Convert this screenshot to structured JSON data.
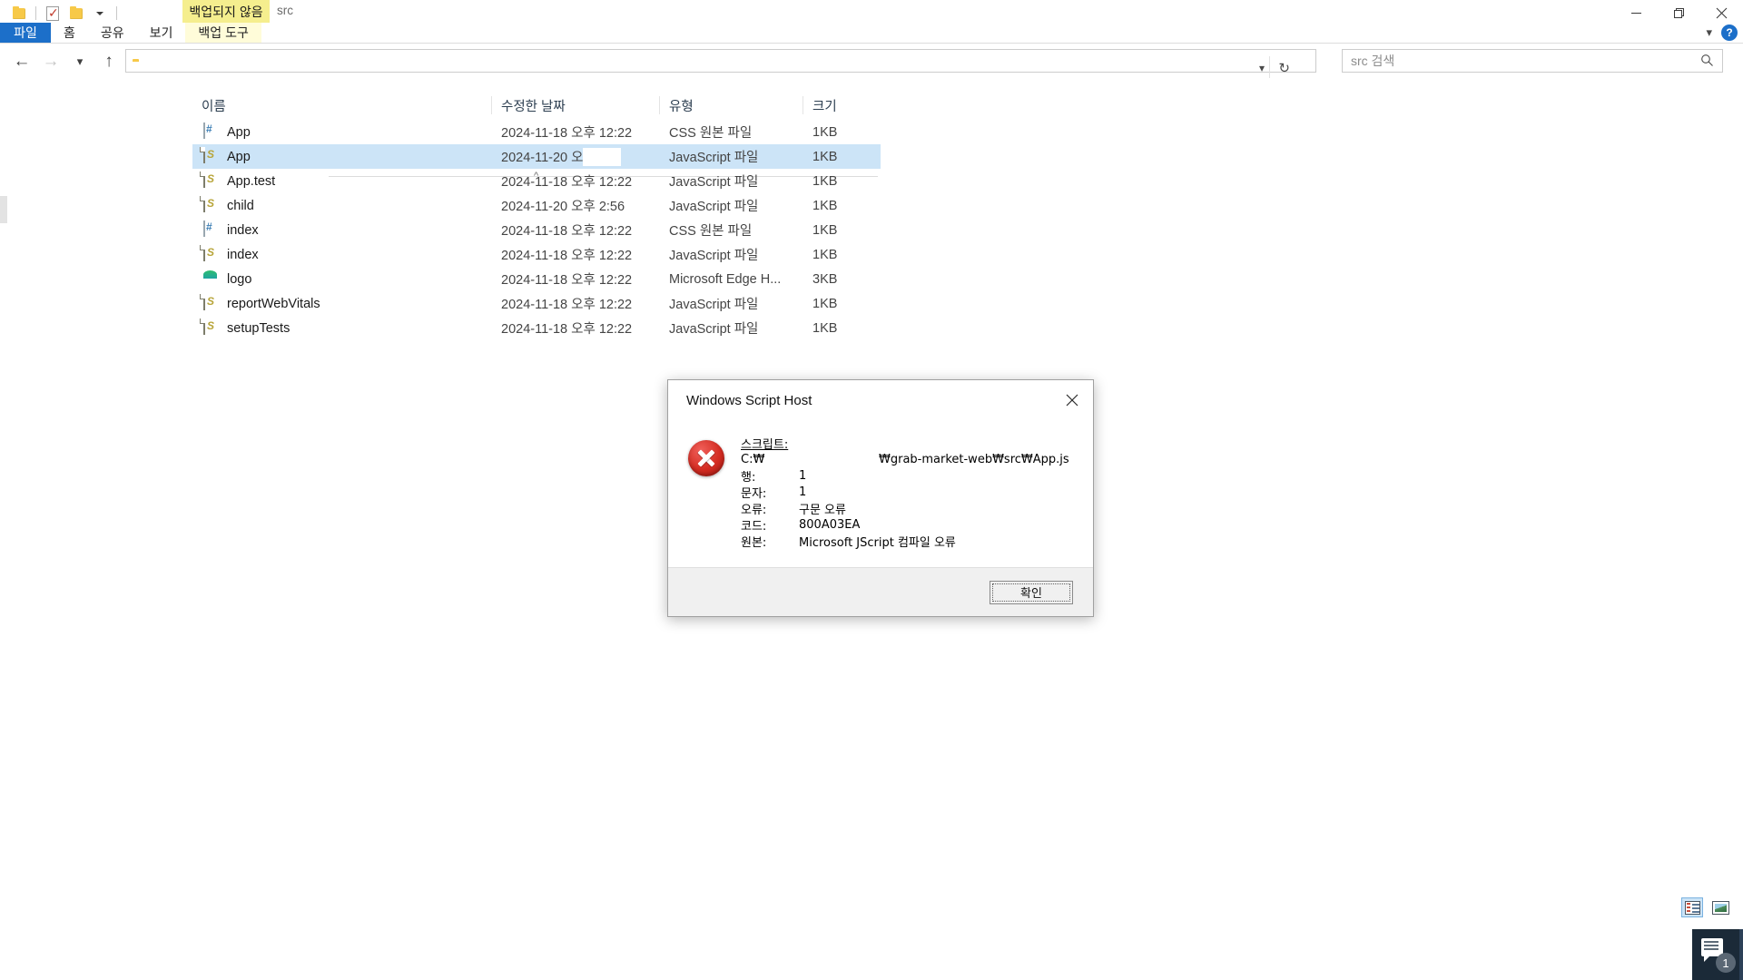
{
  "window": {
    "title": "src",
    "quick_access": {
      "folder_icon": "folder-icon",
      "properties_icon": "properties-checklist-icon",
      "new_folder_icon": "new-folder-icon",
      "customize_icon": "chevron-down-icon"
    },
    "controls": {
      "minimize": "minimize-icon",
      "maximize": "restore-icon",
      "close": "close-icon"
    }
  },
  "ribbon": {
    "tabs": [
      {
        "label": "파일",
        "name": "tab-file"
      },
      {
        "label": "홈",
        "name": "tab-home"
      },
      {
        "label": "공유",
        "name": "tab-share"
      },
      {
        "label": "보기",
        "name": "tab-view"
      },
      {
        "label": "백업 도구",
        "name": "tab-backup-tools"
      }
    ],
    "contextual_banner": "백업되지 않음",
    "collapse_icon": "chevron-down-icon",
    "help_label": "?"
  },
  "navigation": {
    "back_icon": "arrow-left-icon",
    "forward_icon": "arrow-right-icon",
    "recent_icon": "chevron-down-icon",
    "up_icon": "arrow-up-icon",
    "address_value": "",
    "address_dropdown_icon": "chevron-down-icon",
    "refresh_icon": "refresh-icon"
  },
  "search": {
    "placeholder": "src 검색",
    "icon": "search-icon"
  },
  "columns": [
    {
      "label": "이름",
      "name": "column-name"
    },
    {
      "label": "수정한 날짜",
      "name": "column-date-modified"
    },
    {
      "label": "유형",
      "name": "column-type"
    },
    {
      "label": "크기",
      "name": "column-size"
    }
  ],
  "sort_indicator": "^",
  "files": [
    {
      "name": "App",
      "date": "2024-11-18 오후 12:22",
      "type": "CSS 원본 파일",
      "size": "1KB",
      "icon": "css-file-icon",
      "selected": false
    },
    {
      "name": "App",
      "date": "2024-11-20 오후",
      "type": "JavaScript 파일",
      "size": "1KB",
      "icon": "js-file-icon",
      "selected": true
    },
    {
      "name": "App.test",
      "date": "2024-11-18 오후 12:22",
      "type": "JavaScript 파일",
      "size": "1KB",
      "icon": "js-file-icon",
      "selected": false
    },
    {
      "name": "child",
      "date": "2024-11-20 오후 2:56",
      "type": "JavaScript 파일",
      "size": "1KB",
      "icon": "js-file-icon",
      "selected": false
    },
    {
      "name": "index",
      "date": "2024-11-18 오후 12:22",
      "type": "CSS 원본 파일",
      "size": "1KB",
      "icon": "css-file-icon",
      "selected": false
    },
    {
      "name": "index",
      "date": "2024-11-18 오후 12:22",
      "type": "JavaScript 파일",
      "size": "1KB",
      "icon": "js-file-icon",
      "selected": false
    },
    {
      "name": "logo",
      "date": "2024-11-18 오후 12:22",
      "type": "Microsoft Edge H...",
      "size": "3KB",
      "icon": "edge-file-icon",
      "selected": false
    },
    {
      "name": "reportWebVitals",
      "date": "2024-11-18 오후 12:22",
      "type": "JavaScript 파일",
      "size": "1KB",
      "icon": "js-file-icon",
      "selected": false
    },
    {
      "name": "setupTests",
      "date": "2024-11-18 오후 12:22",
      "type": "JavaScript 파일",
      "size": "1KB",
      "icon": "js-file-icon",
      "selected": false
    }
  ],
  "dialog": {
    "title": "Windows Script Host",
    "close_icon": "close-icon",
    "error_icon": "error-icon",
    "rows": [
      {
        "label": "스크립트:",
        "value": ""
      },
      {
        "label": "C:₩",
        "value": "₩grab-market-web₩src₩App.js"
      },
      {
        "label": "행:",
        "value": "1"
      },
      {
        "label": "문자:",
        "value": "1"
      },
      {
        "label": "오류:",
        "value": "구문 오류"
      },
      {
        "label": "코드:",
        "value": "800A03EA"
      },
      {
        "label": "원본:",
        "value": "Microsoft JScript 컴파일 오류"
      }
    ],
    "ok_label": "확인"
  },
  "statusbar": {
    "details_view_icon": "details-view-icon",
    "thumbnail_view_icon": "thumbnail-view-icon"
  },
  "tray": {
    "notification_icon": "notification-icon",
    "badge_count": "1"
  },
  "colors": {
    "accent": "#1c6fc9",
    "selection": "#cce4f7",
    "contextual_tab": "#f5ee8e",
    "error_red": "#d42c22"
  }
}
